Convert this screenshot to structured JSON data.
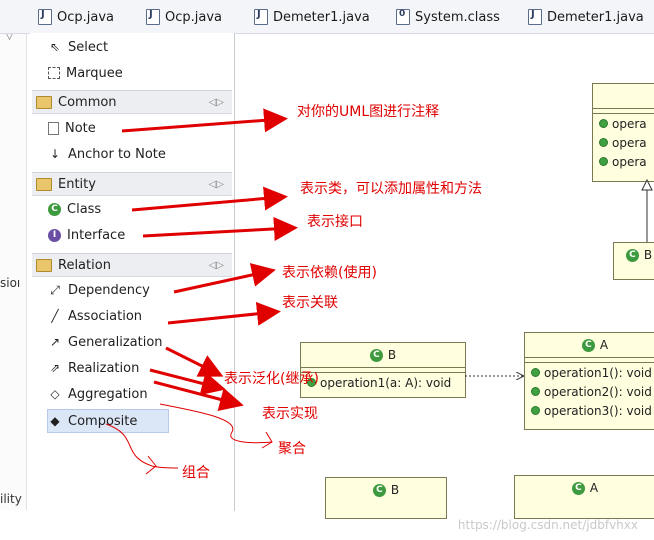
{
  "tabs": [
    {
      "label": "Ocp.java",
      "icon": "java-file-icon"
    },
    {
      "label": "Ocp.java",
      "icon": "java-file-icon"
    },
    {
      "label": "Demeter1.java",
      "icon": "java-file-icon"
    },
    {
      "label": "System.class",
      "icon": "class-file-icon"
    },
    {
      "label": "Demeter1.java",
      "icon": "java-file-icon"
    }
  ],
  "left_stub": {
    "top_label": "コ",
    "mid_label": "sioı",
    "bottom_label": "ility"
  },
  "palette": {
    "tools": [
      {
        "label": "Select"
      },
      {
        "label": "Marquee"
      }
    ],
    "drawers": {
      "common": {
        "label": "Common",
        "items": [
          {
            "label": "Note"
          },
          {
            "label": "Anchor to Note"
          }
        ]
      },
      "entity": {
        "label": "Entity",
        "items": [
          {
            "label": "Class"
          },
          {
            "label": "Interface"
          }
        ]
      },
      "relation": {
        "label": "Relation",
        "items": [
          {
            "label": "Dependency"
          },
          {
            "label": "Association"
          },
          {
            "label": "Generalization"
          },
          {
            "label": "Realization"
          },
          {
            "label": "Aggregation"
          },
          {
            "label": "Composite"
          }
        ]
      }
    }
  },
  "canvas": {
    "top_right_box": {
      "ops": [
        "opera",
        "opera",
        "opera"
      ]
    },
    "small_box_b": {
      "name": "B"
    },
    "class_b": {
      "name": "B",
      "op": "operation1(a: A): void"
    },
    "class_a": {
      "name": "A",
      "ops": [
        "operation1(): void",
        "operation2(): void",
        "operation3(): void"
      ]
    },
    "bottom_b": {
      "name": "B"
    },
    "bottom_a": {
      "name": "A"
    }
  },
  "annotations": {
    "note": "对你的UML图进行注释",
    "class": "表示类，可以添加属性和方法",
    "interface": "表示接口",
    "dependency": "表示依赖(使用)",
    "association": "表示关联",
    "generalization": "表示泛化(继承)",
    "realization": "表示实现",
    "aggregation": "聚合",
    "composite": "组合"
  },
  "watermark": "https://blog.csdn.net/jdbfvhxx",
  "colors": {
    "annotation": "#e00000",
    "uml_fill": "#ffffe0",
    "uml_icon": "#3e9a3e"
  }
}
